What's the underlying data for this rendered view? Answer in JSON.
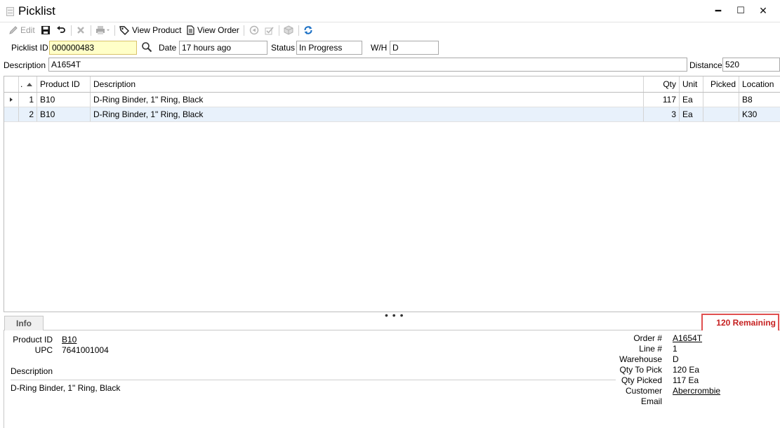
{
  "window": {
    "title": "Picklist",
    "minimize": "━",
    "maximize": "☐",
    "close": "✕"
  },
  "toolbar": {
    "edit": "Edit",
    "view_product": "View Product",
    "view_order": "View Order"
  },
  "form": {
    "picklist_id_label": "Picklist ID",
    "picklist_id": "000000483",
    "date_label": "Date",
    "date": "17 hours ago",
    "status_label": "Status",
    "status": "In Progress",
    "wh_label": "W/H",
    "wh": "D",
    "description_label": "Description",
    "description": "A1654T",
    "distance_label": "Distance",
    "distance": "520"
  },
  "grid": {
    "headers": {
      "num": ".",
      "product_id": "Product ID",
      "description": "Description",
      "qty": "Qty",
      "unit": "Unit",
      "picked": "Picked",
      "location": "Location"
    },
    "rows": [
      {
        "num": "1",
        "product_id": "B10",
        "description": "D-Ring Binder, 1\" Ring, Black",
        "qty": "117",
        "unit": "Ea",
        "picked": "",
        "location": "B8"
      },
      {
        "num": "2",
        "product_id": "B10",
        "description": "D-Ring Binder, 1\" Ring, Black",
        "qty": "3",
        "unit": "Ea",
        "picked": "",
        "location": "K30"
      }
    ]
  },
  "splitter": "• • •",
  "info": {
    "tab": "Info",
    "remaining": "120 Remaining",
    "product_id_label": "Product ID",
    "product_id": "B10",
    "upc_label": "UPC",
    "upc": "7641001004",
    "description_label": "Description",
    "description": "D-Ring Binder, 1\" Ring, Black",
    "order_label": "Order #",
    "order": "A1654T",
    "line_label": "Line #",
    "line": "1",
    "warehouse_label": "Warehouse",
    "warehouse": "D",
    "qty_to_pick_label": "Qty To Pick",
    "qty_to_pick": "120 Ea",
    "qty_picked_label": "Qty Picked",
    "qty_picked": "117 Ea",
    "customer_label": "Customer",
    "customer": "Abercrombie",
    "email_label": "Email",
    "email": ""
  }
}
